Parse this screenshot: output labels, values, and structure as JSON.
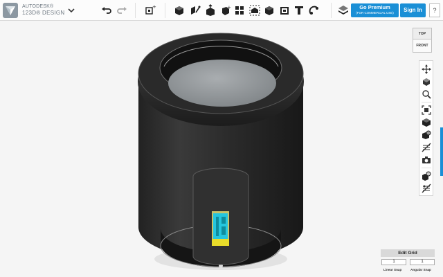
{
  "app": {
    "brand_line1": "AUTODESK®",
    "brand_line2": "123D® DESIGN"
  },
  "toolbar": {
    "icons": [
      "undo-icon",
      "redo-icon",
      "primitives-icon",
      "sketch-icon",
      "construct-icon",
      "modify-icon",
      "pattern-icon",
      "group-icon",
      "combine-icon",
      "measure-icon",
      "text-icon",
      "snap-icon",
      "material-icon"
    ],
    "premium_label": "Go Premium",
    "premium_sub": "(FOR COMMERCIAL USE)",
    "signin_label": "Sign In",
    "help_label": "?"
  },
  "viewcube": {
    "top": "TOP",
    "front": "FRONT"
  },
  "nav": {
    "icons": [
      "pan-icon",
      "orbit-icon",
      "zoom-icon",
      "fit-icon",
      "view-solid-icon",
      "materials-view-icon",
      "hide-icon",
      "screenshot-icon",
      "visibility-icon",
      "hide-sketch-icon"
    ]
  },
  "grid": {
    "title": "Edit Grid",
    "linear_value": "1",
    "angular_value": "1",
    "linear_label": "Linear Snap",
    "angular_label": "Angular Snap"
  },
  "colors": {
    "accent": "#1a8fd6",
    "body": "#2c2c2c",
    "cyan": "#25c6de",
    "yellow": "#e8dc2a"
  }
}
